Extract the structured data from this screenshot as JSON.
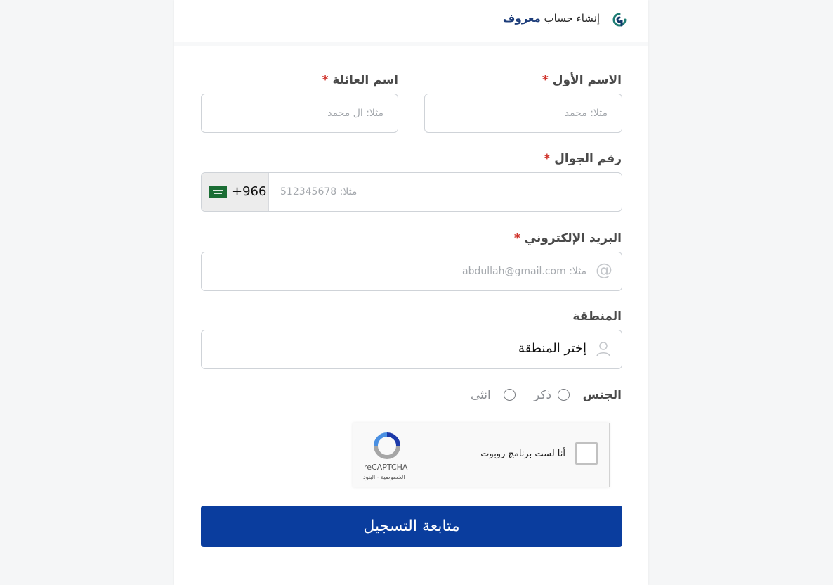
{
  "header": {
    "title_prefix": "إنشاء حساب",
    "brand": "معروف"
  },
  "form": {
    "first_name": {
      "label": "الاسم الأول",
      "required_mark": "*",
      "placeholder": "مثلا: محمد"
    },
    "last_name": {
      "label": "اسم العائلة",
      "required_mark": "*",
      "placeholder": "مثلا: ال محمد"
    },
    "phone": {
      "label": "رقم الجوال",
      "required_mark": "*",
      "country_code": "+966",
      "placeholder": "مثلا: 512345678"
    },
    "email": {
      "label": "البريد الإلكتروني",
      "required_mark": "*",
      "placeholder": "مثلا: abdullah@gmail.com",
      "icon": "@"
    },
    "region": {
      "label": "المنطقة",
      "value": "إختر المنطقة"
    },
    "gender": {
      "label": "الجنس",
      "options": [
        "ذكر",
        "انثى"
      ]
    },
    "captcha": {
      "text": "أنا لست برنامج روبوت",
      "brand": "reCAPTCHA",
      "links": "الخصوصية - البنود"
    },
    "submit_label": "متابعة التسجيل"
  },
  "colors": {
    "brand_blue": "#0a3d9e",
    "required": "#d0332b",
    "logo_teal": "#1f7d74",
    "flag_green": "#1a6d34"
  }
}
